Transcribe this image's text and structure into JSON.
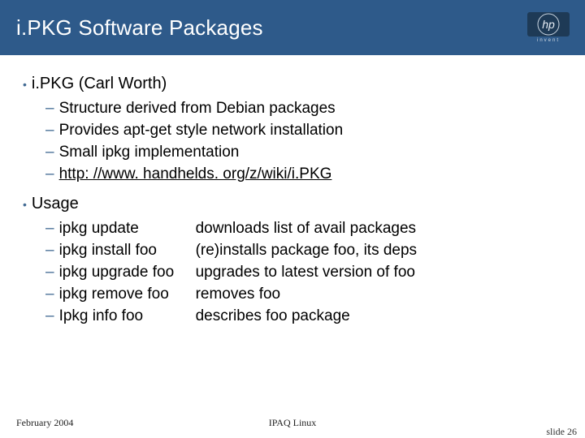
{
  "title": "i.PKG Software Packages",
  "logo": {
    "text": "hp",
    "sub": "invent"
  },
  "sections": [
    {
      "heading": "i.PKG (Carl Worth)",
      "items": [
        {
          "text": "Structure derived from Debian packages",
          "link": false
        },
        {
          "text": "Provides apt-get style network installation",
          "link": false
        },
        {
          "text": "Small ipkg implementation",
          "link": false
        },
        {
          "text": "http: //www. handhelds. org/z/wiki/i.PKG",
          "link": true
        }
      ]
    },
    {
      "heading": "Usage",
      "usage": [
        {
          "cmd": "ipkg update",
          "desc": "downloads list of avail packages"
        },
        {
          "cmd": "ipkg install foo",
          "desc": "(re)installs package foo, its deps"
        },
        {
          "cmd": "ipkg upgrade foo",
          "desc": "upgrades to latest version of foo"
        },
        {
          "cmd": "ipkg remove foo",
          "desc": "removes foo"
        },
        {
          "cmd": "Ipkg info foo",
          "desc": "describes foo package"
        }
      ]
    }
  ],
  "footer": {
    "left": "February 2004",
    "center": "IPAQ Linux",
    "right": "slide 26"
  }
}
